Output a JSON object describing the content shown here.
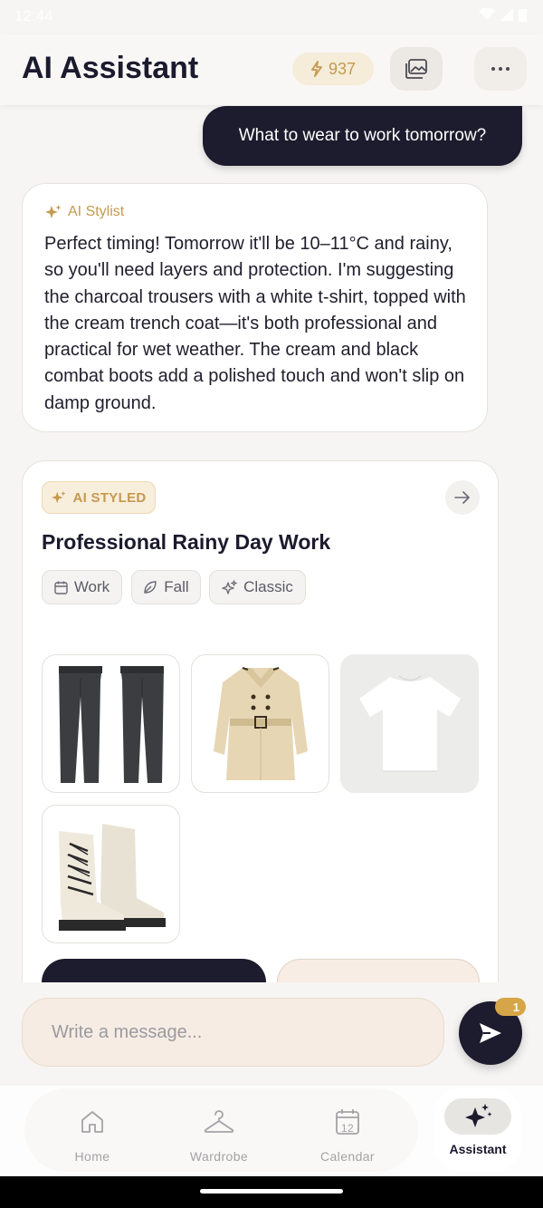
{
  "status_bar": {
    "time": "12:44"
  },
  "header": {
    "title": "AI Assistant",
    "credits": "937",
    "gallery_icon": "gallery-icon",
    "more_icon": "more-dots-icon"
  },
  "messages": {
    "user": "What to wear to work tomorrow?",
    "ai_label": "AI Stylist",
    "ai_text": "Perfect timing! Tomorrow it'll be 10–11°C and rainy, so you'll need layers and protection. I'm suggesting the charcoal trousers with a white t-shirt, topped with the cream trench coat—it's both professional and practical for wet weather. The cream and black combat boots add a polished touch and won't slip on damp ground."
  },
  "outfit": {
    "badge": "AI STYLED",
    "title": "Professional Rainy Day Work",
    "tags": [
      "Work",
      "Fall",
      "Classic"
    ],
    "items": [
      "charcoal-trousers",
      "cream-trench-coat",
      "white-t-shirt",
      "cream-combat-boots"
    ]
  },
  "composer": {
    "placeholder": "Write a message...",
    "badge_count": "1"
  },
  "nav": {
    "items": [
      {
        "label": "Home",
        "icon": "home-icon"
      },
      {
        "label": "Wardrobe",
        "icon": "hanger-icon"
      },
      {
        "label": "Calendar",
        "icon": "calendar-icon",
        "date": "12"
      },
      {
        "label": "Assistant",
        "icon": "sparkle-icon",
        "active": true
      }
    ]
  },
  "colors": {
    "accent": "#c59a4f",
    "dark": "#1d1c2e",
    "background": "#f7f5f3"
  }
}
